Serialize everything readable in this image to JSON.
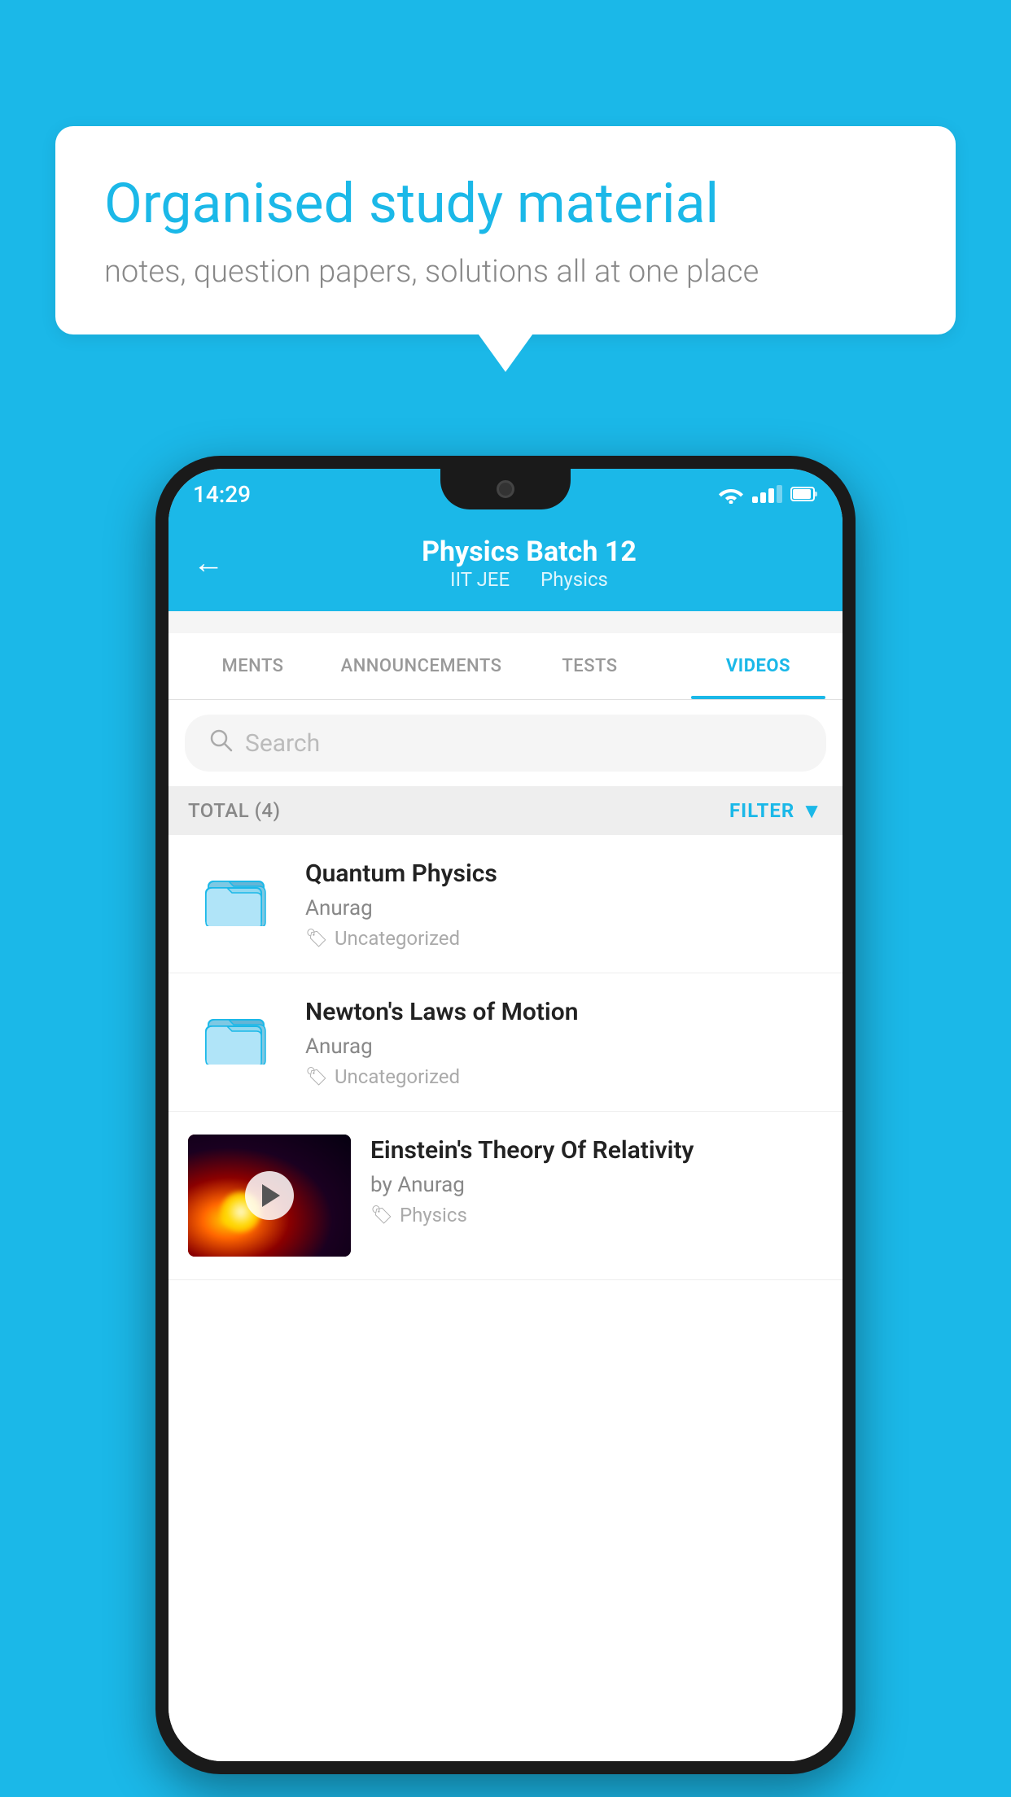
{
  "background_color": "#1BB8E8",
  "bubble": {
    "title": "Organised study material",
    "subtitle": "notes, question papers, solutions all at one place"
  },
  "status_bar": {
    "time": "14:29",
    "wifi": "▼",
    "battery": "🔋"
  },
  "header": {
    "title": "Physics Batch 12",
    "subtitle_part1": "IIT JEE",
    "subtitle_part2": "Physics",
    "back_label": "←"
  },
  "tabs": [
    {
      "id": "ments",
      "label": "MENTS",
      "active": false
    },
    {
      "id": "announcements",
      "label": "ANNOUNCEMENTS",
      "active": false
    },
    {
      "id": "tests",
      "label": "TESTS",
      "active": false
    },
    {
      "id": "videos",
      "label": "VIDEOS",
      "active": true
    }
  ],
  "search": {
    "placeholder": "Search"
  },
  "filter_bar": {
    "total_label": "TOTAL (4)",
    "filter_label": "FILTER"
  },
  "videos": [
    {
      "id": "v1",
      "title": "Quantum Physics",
      "author": "Anurag",
      "tag": "Uncategorized",
      "type": "folder",
      "has_thumbnail": false
    },
    {
      "id": "v2",
      "title": "Newton's Laws of Motion",
      "author": "Anurag",
      "tag": "Uncategorized",
      "type": "folder",
      "has_thumbnail": false
    },
    {
      "id": "v3",
      "title": "Einstein's Theory Of Relativity",
      "author": "by Anurag",
      "tag": "Physics",
      "type": "video",
      "has_thumbnail": true
    }
  ]
}
